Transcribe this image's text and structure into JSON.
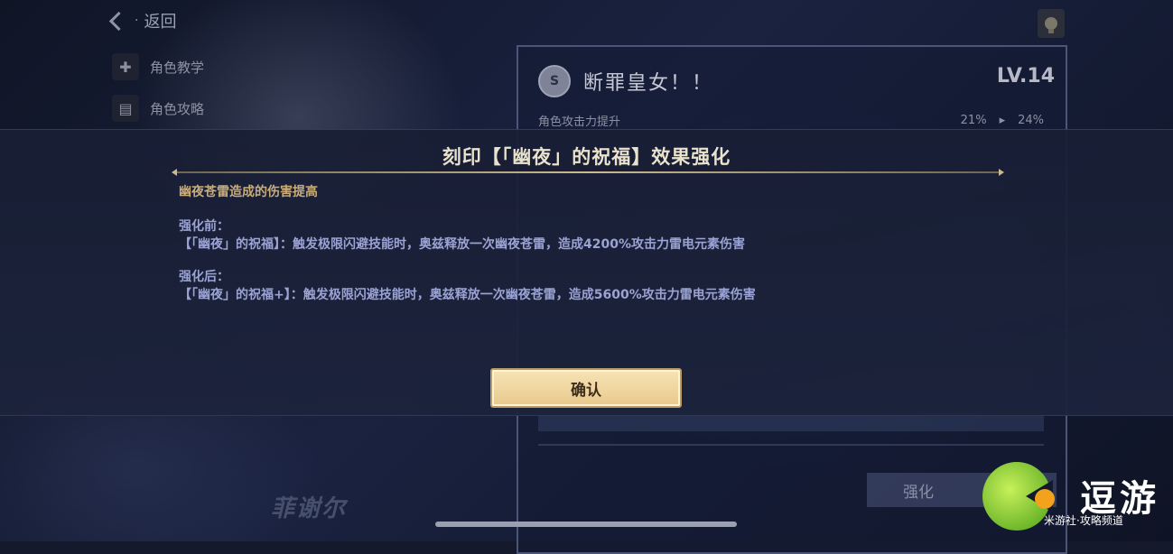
{
  "top_bar": {
    "back_label": "返回",
    "back_dot": "·"
  },
  "side_menu": [
    {
      "label": "角色教学",
      "icon": "gamepad-icon"
    },
    {
      "label": "角色攻略",
      "icon": "book-icon"
    }
  ],
  "stigma_panel": {
    "title": "断罪皇女！！",
    "badge": "S",
    "level": "LV.14",
    "stat_label": "角色攻击力提升",
    "stat_before": "21%",
    "stat_after": "24%",
    "button_label": "强化"
  },
  "character_name": "菲谢尔",
  "modal": {
    "title": "刻印【「幽夜」的祝福】效果强化",
    "description": "幽夜苍雷造成的伤害提高",
    "before_label": "强化前：",
    "before_text": "【「幽夜」的祝福】：触发极限闪避技能时，奥兹释放一次幽夜苍雷，造成4200%攻击力雷电元素伤害",
    "after_label": "强化后：",
    "after_text": "【「幽夜」的祝福+】：触发极限闪避技能时，奥兹释放一次幽夜苍雷，造成5600%攻击力雷电元素伤害",
    "confirm_label": "确认"
  },
  "watermark": {
    "text": "逗游",
    "sub": "米游社·攻略频道"
  },
  "colors": {
    "accent_gold": "#e9c98c",
    "text_gold": "#c9ac7a",
    "text_blue": "#9aa3d4"
  }
}
